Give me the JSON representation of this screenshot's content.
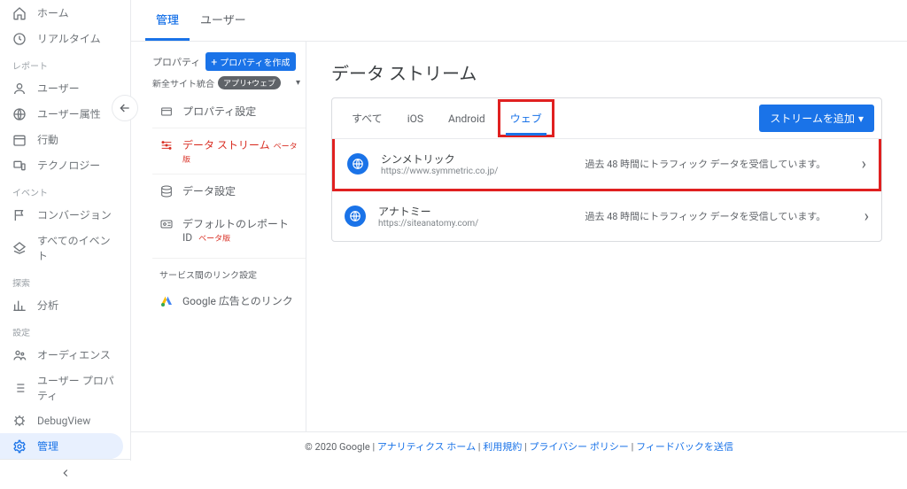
{
  "leftnav": {
    "home": "ホーム",
    "realtime": "リアルタイム",
    "grp_report": "レポート",
    "users": "ユーザー",
    "userattr": "ユーザー属性",
    "behavior": "行動",
    "technology": "テクノロジー",
    "grp_event": "イベント",
    "conversion": "コンバージョン",
    "allevents": "すべてのイベント",
    "grp_explore": "探索",
    "analysis": "分析",
    "grp_settings": "設定",
    "audience": "オーディエンス",
    "userprop": "ユーザー プロパティ",
    "debugview": "DebugView",
    "admin": "管理"
  },
  "tabs": {
    "admin": "管理",
    "user": "ユーザー"
  },
  "property": {
    "label": "プロパティ",
    "create": "プロパティを作成",
    "site": "新全サイト統合",
    "appweb": "アプリ+ウェブ"
  },
  "midnav": {
    "settings": "プロパティ設定",
    "datastream": "データ ストリーム",
    "datastream_tag": "ベータ版",
    "datasettings": "データ設定",
    "defaultreport": "デフォルトのレポート ID",
    "defaultreport_tag": "ベータ版",
    "section": "サービス間のリンク設定",
    "adslink": "Google 広告とのリンク"
  },
  "page": {
    "title": "データ ストリーム"
  },
  "streamtabs": {
    "all": "すべて",
    "ios": "iOS",
    "android": "Android",
    "web": "ウェブ",
    "add": "ストリームを追加"
  },
  "rows": [
    {
      "name": "シンメトリック",
      "url": "https://www.symmetric.co.jp/",
      "status": "過去 48 時間にトラフィック データを受信しています。"
    },
    {
      "name": "アナトミー",
      "url": "https://siteanatomy.com/",
      "status": "過去 48 時間にトラフィック データを受信しています。"
    }
  ],
  "footer": {
    "copyright": "© 2020 Google",
    "home": "アナリティクス ホーム",
    "terms": "利用規約",
    "privacy": "プライバシー ポリシー",
    "feedback": "フィードバックを送信"
  }
}
